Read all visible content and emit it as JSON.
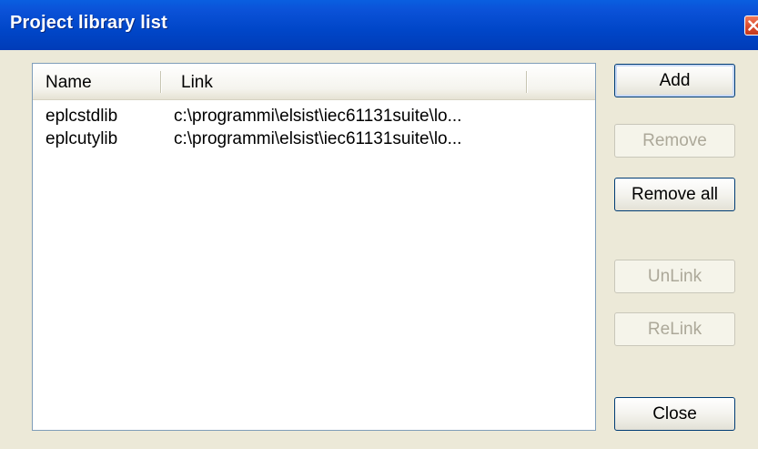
{
  "window": {
    "title": "Project library list"
  },
  "list": {
    "columns": [
      "Name",
      "Link"
    ],
    "rows": [
      {
        "name": "eplcstdlib",
        "link": "c:\\programmi\\elsist\\iec61131suite\\lo..."
      },
      {
        "name": "eplcutylib",
        "link": "c:\\programmi\\elsist\\iec61131suite\\lo..."
      }
    ]
  },
  "buttons": {
    "add": "Add",
    "remove": "Remove",
    "remove_all": "Remove all",
    "unlink": "UnLink",
    "relink": "ReLink",
    "close": "Close"
  },
  "colors": {
    "titlebar": "#0046c8",
    "dialog_bg": "#ece9d8",
    "disabled_text": "#aca899"
  },
  "icons": {
    "close": "close-icon"
  }
}
